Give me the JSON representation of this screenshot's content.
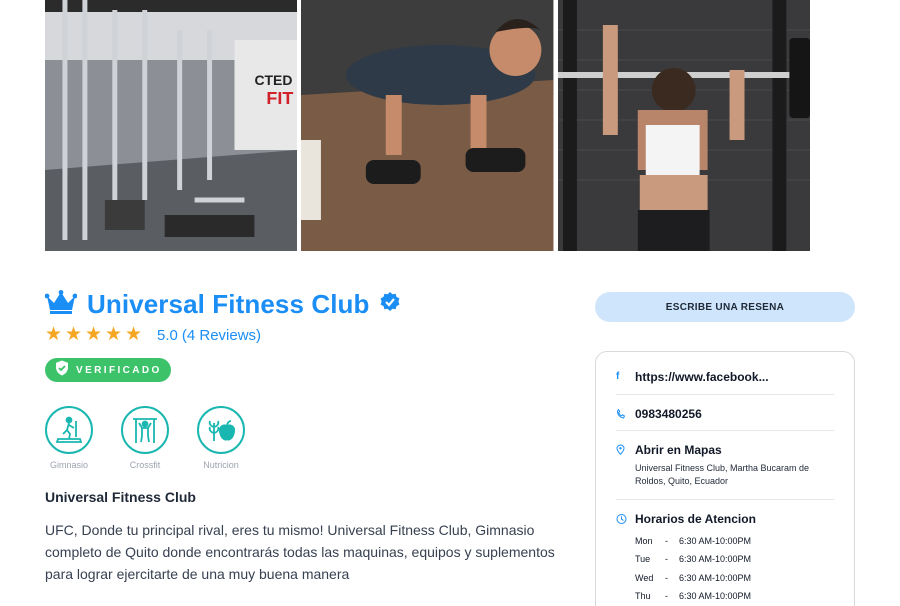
{
  "gallery": {
    "photos": [
      "gym-interior-photo",
      "pushup-dumbbells-photo",
      "barbell-lift-photo"
    ]
  },
  "listing": {
    "title": "Universal Fitness Club",
    "rating_value": "5.0",
    "rating_reviews": "(4 Reviews)",
    "stars": 5,
    "badge_label": "VERIFICADO"
  },
  "categories": [
    {
      "label": "Gimnasio",
      "icon": "treadmill-icon"
    },
    {
      "label": "Crossfit",
      "icon": "crossfit-icon"
    },
    {
      "label": "Nutricion",
      "icon": "nutrition-icon"
    }
  ],
  "description": {
    "title": "Universal Fitness Club",
    "text": "UFC, Donde tu principal rival, eres tu mismo! Universal Fitness Club, Gimnasio completo de Quito donde encontrarás todas las maquinas, equipos y suplementos para lograr ejercitarte de una muy buena manera"
  },
  "sidebar": {
    "review_button": "ESCRIBE UNA RESENA",
    "facebook": "https://www.facebook...",
    "phone": "0983480256",
    "maps_label": "Abrir en Mapas",
    "address": "Universal Fitness Club, Martha Bucaram de Roldos, Quito, Ecuador",
    "hours_title": "Horarios de Atencion",
    "hours": [
      {
        "day": "Mon",
        "sep": "-",
        "time": "6:30 AM-10:00PM"
      },
      {
        "day": "Tue",
        "sep": "-",
        "time": "6:30 AM-10:00PM"
      },
      {
        "day": "Wed",
        "sep": "-",
        "time": "6:30 AM-10:00PM"
      },
      {
        "day": "Thu",
        "sep": "-",
        "time": "6:30 AM-10:00PM"
      }
    ]
  },
  "colors": {
    "brand_blue": "#1a8ef5",
    "star": "#f5a623",
    "verified_green": "#3cc36a",
    "category_teal": "#1ab7b0",
    "review_button_bg": "#cfe5fb"
  }
}
